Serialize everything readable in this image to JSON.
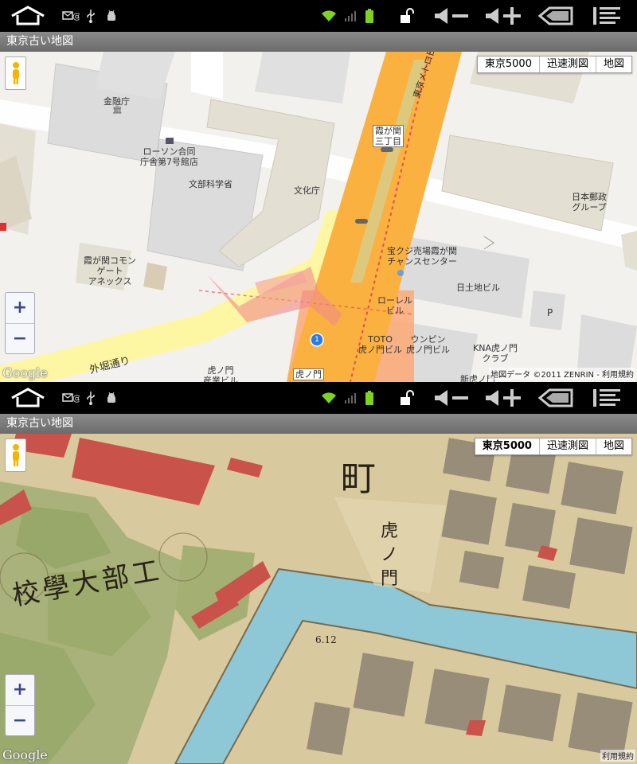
{
  "statusbar": {
    "icons": [
      "home-icon",
      "email-notification-icon",
      "usb-icon",
      "android-debug-icon",
      "wifi-icon",
      "signal-icon",
      "battery-icon",
      "unlock-icon",
      "volume-down-icon",
      "volume-up-icon",
      "back-icon",
      "menu-icon"
    ]
  },
  "app": {
    "title": "東京古い地図"
  },
  "map_types": [
    "東京5000",
    "迅速測図",
    "地図"
  ],
  "zoom": {
    "in": "+",
    "out": "−"
  },
  "google_logo": "Google",
  "screen1": {
    "selected_type": "地図",
    "attribution": "地図データ ©2011 ZENRIN - 利用規約",
    "labels": {
      "kinyucho": "金融庁",
      "lawson": "ローソン合同\n庁舎第7号館店",
      "monbu": "文部科学省",
      "bunka": "文化庁",
      "kasumi_annex": "霞が関コモン\nゲート\nアネックス",
      "nihon_yusei": "日本郵政\nグループ",
      "takarakuji": "宝クジ売場霞が関\nチャンスセンター",
      "nittochi": "日土地ビル",
      "laurel": "ローレル\nビル",
      "toto": "TOTO\n虎ノ門ビル",
      "unpin": "ウンピン\n虎ノ門ビル",
      "kna": "KNA虎ノ門\nクラブ",
      "toranomon_sangyo": "虎ノ門\n産業ビル",
      "shin_toranomon": "新虎ノ門",
      "sotobori": "外堀通り",
      "metro": "東京メトロ日",
      "station_kasumi": "霞が関\n三丁目",
      "station_tora": "虎ノ門",
      "route1": "1"
    }
  },
  "screen2": {
    "selected_type": "東京5000",
    "attribution": "利用規約",
    "labels": {
      "machi": "町",
      "tora": "虎\nノ\n門",
      "kogakubu": "校學大部工",
      "elev": "6.12"
    }
  }
}
